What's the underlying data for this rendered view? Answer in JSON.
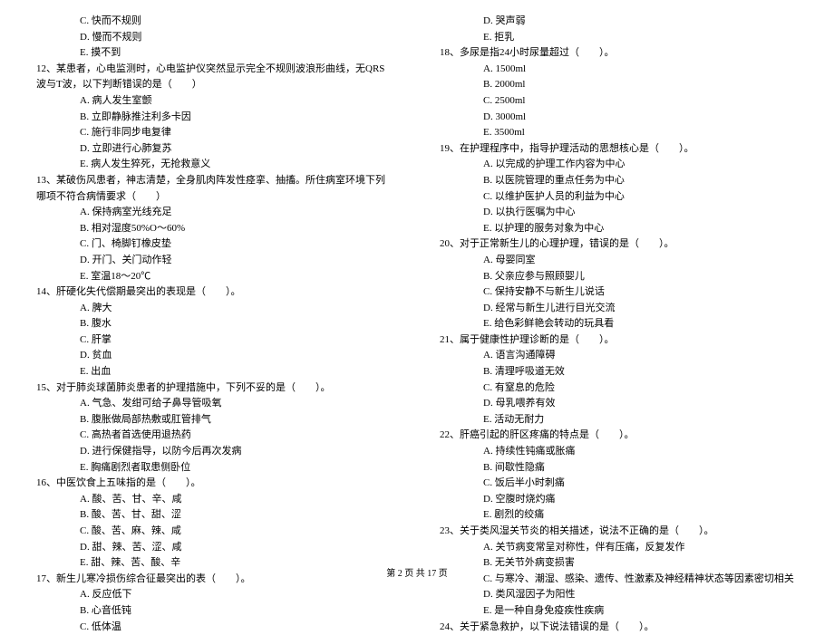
{
  "left_column": [
    {
      "type": "option",
      "text": "C. 快而不规则"
    },
    {
      "type": "option",
      "text": "D. 慢而不规则"
    },
    {
      "type": "option",
      "text": "E. 摸不到"
    },
    {
      "type": "question",
      "text": "12、某患者，心电监测时，心电监护仪突然显示完全不规则波浪形曲线，无QRS波与T波，以下判断错误的是（　　）"
    },
    {
      "type": "option",
      "text": "A. 病人发生室颤"
    },
    {
      "type": "option",
      "text": "B. 立即静脉推注利多卡因"
    },
    {
      "type": "option",
      "text": "C. 施行非同步电复律"
    },
    {
      "type": "option",
      "text": "D. 立即进行心肺复苏"
    },
    {
      "type": "option",
      "text": "E. 病人发生猝死，无抢救意义"
    },
    {
      "type": "question",
      "text": "13、某破伤风患者，神志清楚，全身肌肉阵发性痉挛、抽搐。所住病室环境下列哪项不符合病情要求（　　）"
    },
    {
      "type": "option",
      "text": "A. 保持病室光线充足"
    },
    {
      "type": "option",
      "text": "B. 相对湿度50%O～60%"
    },
    {
      "type": "option",
      "text": "C. 门、椅脚钉橡皮垫"
    },
    {
      "type": "option",
      "text": "D. 开门、关门动作轻"
    },
    {
      "type": "option",
      "text": "E. 室温18～20℃"
    },
    {
      "type": "question",
      "text": "14、肝硬化失代偿期最突出的表现是（　　）。"
    },
    {
      "type": "option",
      "text": "A. 脾大"
    },
    {
      "type": "option",
      "text": "B. 腹水"
    },
    {
      "type": "option",
      "text": "C. 肝掌"
    },
    {
      "type": "option",
      "text": "D. 贫血"
    },
    {
      "type": "option",
      "text": "E. 出血"
    },
    {
      "type": "question",
      "text": "15、对于肺炎球菌肺炎患者的护理措施中，下列不妥的是（　　）。"
    },
    {
      "type": "option",
      "text": "A. 气急、发绀可给子鼻导管吸氧"
    },
    {
      "type": "option",
      "text": "B. 腹胀做局部热敷或肛管排气"
    },
    {
      "type": "option",
      "text": "C. 高热者首选使用退热药"
    },
    {
      "type": "option",
      "text": "D. 进行保健指导，以防今后再次发病"
    },
    {
      "type": "option",
      "text": "E. 胸痛剧烈者取患侧卧位"
    },
    {
      "type": "question",
      "text": "16、中医饮食上五味指的是（　　）。"
    },
    {
      "type": "option",
      "text": "A. 酸、苦、甘、辛、咸"
    },
    {
      "type": "option",
      "text": "B. 酸、苦、甘、甜、涩"
    },
    {
      "type": "option",
      "text": "C. 酸、苦、麻、辣、咸"
    },
    {
      "type": "option",
      "text": "D. 甜、辣、苦、涩、咸"
    },
    {
      "type": "option",
      "text": "E. 甜、辣、苦、酸、辛"
    },
    {
      "type": "question",
      "text": "17、新生儿寒冷损伤综合征最突出的表（　　）。"
    },
    {
      "type": "option",
      "text": "A. 反应低下"
    },
    {
      "type": "option",
      "text": "B. 心音低钝"
    },
    {
      "type": "option",
      "text": "C. 低体温"
    }
  ],
  "right_column": [
    {
      "type": "option",
      "text": "D. 哭声弱"
    },
    {
      "type": "option",
      "text": "E. 拒乳"
    },
    {
      "type": "question",
      "text": "18、多尿是指24小时尿量超过（　　）。"
    },
    {
      "type": "option",
      "text": "A. 1500ml"
    },
    {
      "type": "option",
      "text": "B. 2000ml"
    },
    {
      "type": "option",
      "text": "C. 2500ml"
    },
    {
      "type": "option",
      "text": "D. 3000ml"
    },
    {
      "type": "option",
      "text": "E. 3500ml"
    },
    {
      "type": "question",
      "text": "19、在护理程序中，指导护理活动的思想核心是（　　）。"
    },
    {
      "type": "option",
      "text": "A. 以完成的护理工作内容为中心"
    },
    {
      "type": "option",
      "text": "B. 以医院管理的重点任务为中心"
    },
    {
      "type": "option",
      "text": "C. 以维护医护人员的利益为中心"
    },
    {
      "type": "option",
      "text": "D. 以执行医嘱为中心"
    },
    {
      "type": "option",
      "text": "E. 以护理的服务对象为中心"
    },
    {
      "type": "question",
      "text": "20、对于正常新生儿的心理护理，错误的是（　　）。"
    },
    {
      "type": "option",
      "text": "A. 母婴同室"
    },
    {
      "type": "option",
      "text": "B. 父亲应参与照顾婴儿"
    },
    {
      "type": "option",
      "text": "C. 保持安静不与新生儿说话"
    },
    {
      "type": "option",
      "text": "D. 经常与新生儿进行目光交流"
    },
    {
      "type": "option",
      "text": "E. 给色彩鲜艳会转动的玩具看"
    },
    {
      "type": "question",
      "text": "21、属于健康性护理诊断的是（　　）。"
    },
    {
      "type": "option",
      "text": "A. 语言沟通障碍"
    },
    {
      "type": "option",
      "text": "B. 清理呼吸道无效"
    },
    {
      "type": "option",
      "text": "C. 有窒息的危险"
    },
    {
      "type": "option",
      "text": "D. 母乳喂养有效"
    },
    {
      "type": "option",
      "text": "E. 活动无耐力"
    },
    {
      "type": "question",
      "text": "22、肝癌引起的肝区疼痛的特点是（　　）。"
    },
    {
      "type": "option",
      "text": "A. 持续性钝痛或胀痛"
    },
    {
      "type": "option",
      "text": "B. 间歇性隐痛"
    },
    {
      "type": "option",
      "text": "C. 饭后半小时刺痛"
    },
    {
      "type": "option",
      "text": "D. 空腹时烧灼痛"
    },
    {
      "type": "option",
      "text": "E. 剧烈的绞痛"
    },
    {
      "type": "question",
      "text": "23、关于类风湿关节炎的相关描述，说法不正确的是（　　）。"
    },
    {
      "type": "option",
      "text": "A. 关节病变常呈对称性，伴有压痛，反复发作"
    },
    {
      "type": "option",
      "text": "B. 无关节外病变损害"
    },
    {
      "type": "option",
      "text": "C. 与寒冷、潮湿、感染、遗传、性激素及神经精神状态等因素密切相关"
    },
    {
      "type": "option",
      "text": "D. 类风湿因子为阳性"
    },
    {
      "type": "option",
      "text": "E. 是一种自身免疫疾性疾病"
    },
    {
      "type": "question",
      "text": "24、关于紧急救护，以下说法错误的是（　　）。"
    }
  ],
  "footer": "第 2 页 共 17 页"
}
